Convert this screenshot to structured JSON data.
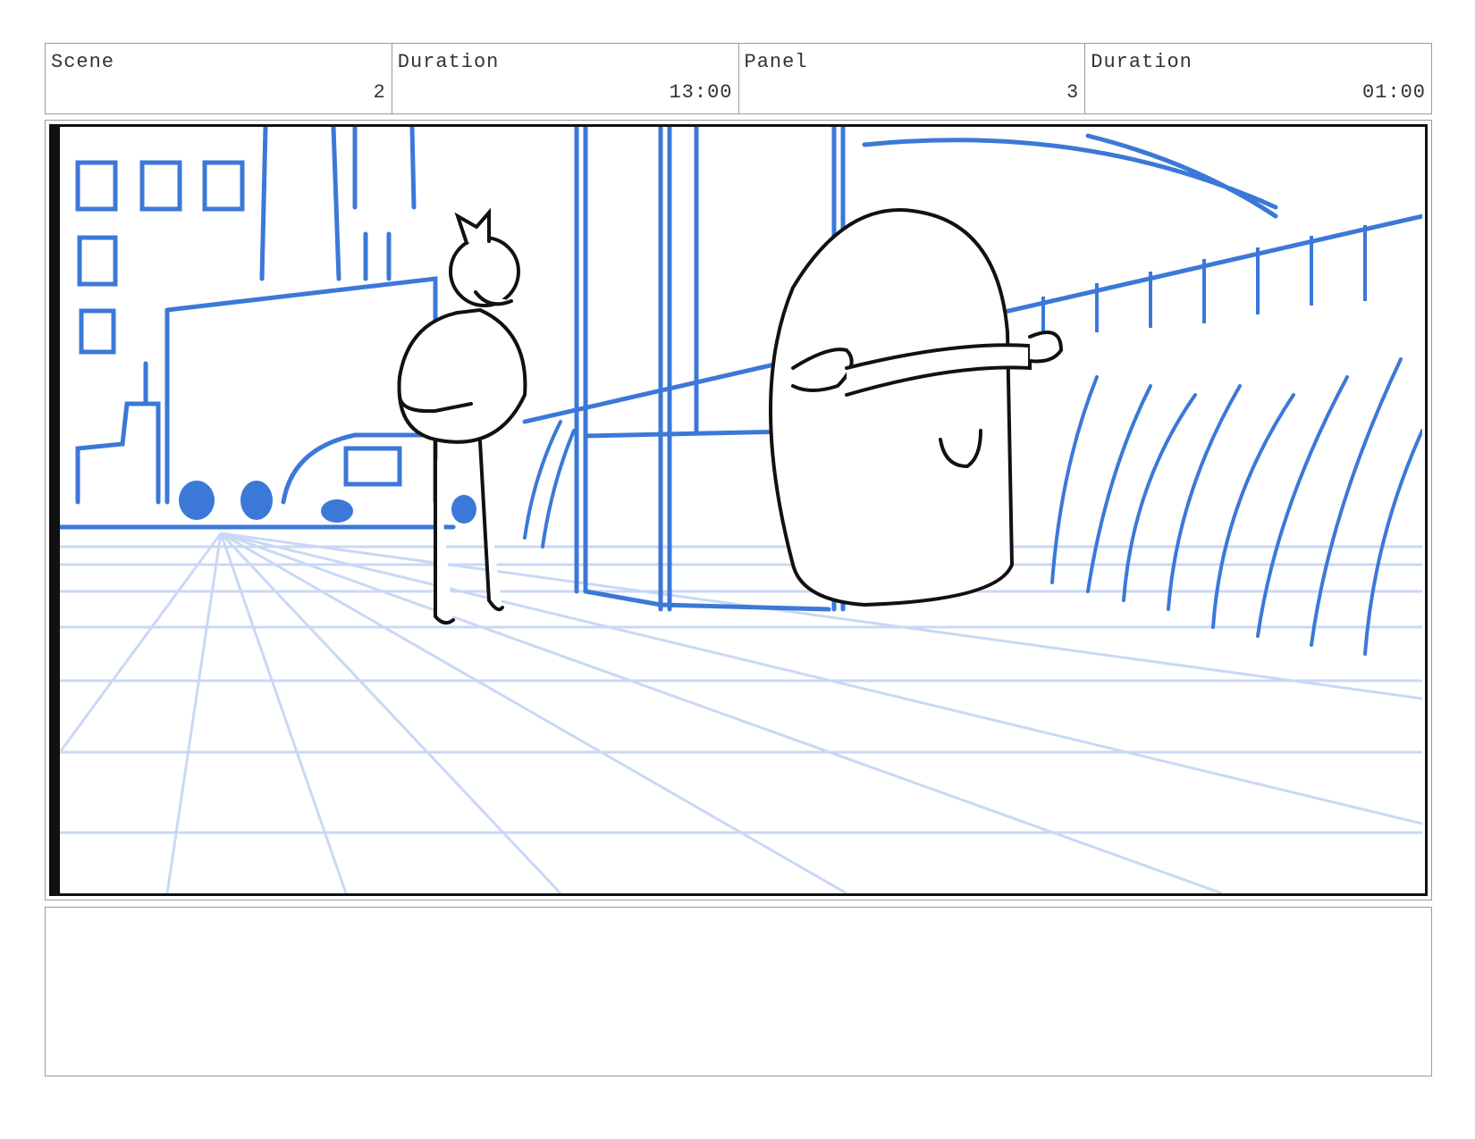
{
  "header": {
    "scene_label": "Scene",
    "scene_value": "2",
    "scene_duration_label": "Duration",
    "scene_duration_value": "13:00",
    "panel_label": "Panel",
    "panel_value": "3",
    "panel_duration_label": "Duration",
    "panel_duration_value": "01:00"
  },
  "panel": {
    "image_icon": "storyboard-sketch",
    "colors": {
      "sketch_blue": "#3b78d8",
      "guide_blue": "#c9d8f5",
      "ink": "#111111"
    }
  },
  "notes": {
    "text": ""
  }
}
